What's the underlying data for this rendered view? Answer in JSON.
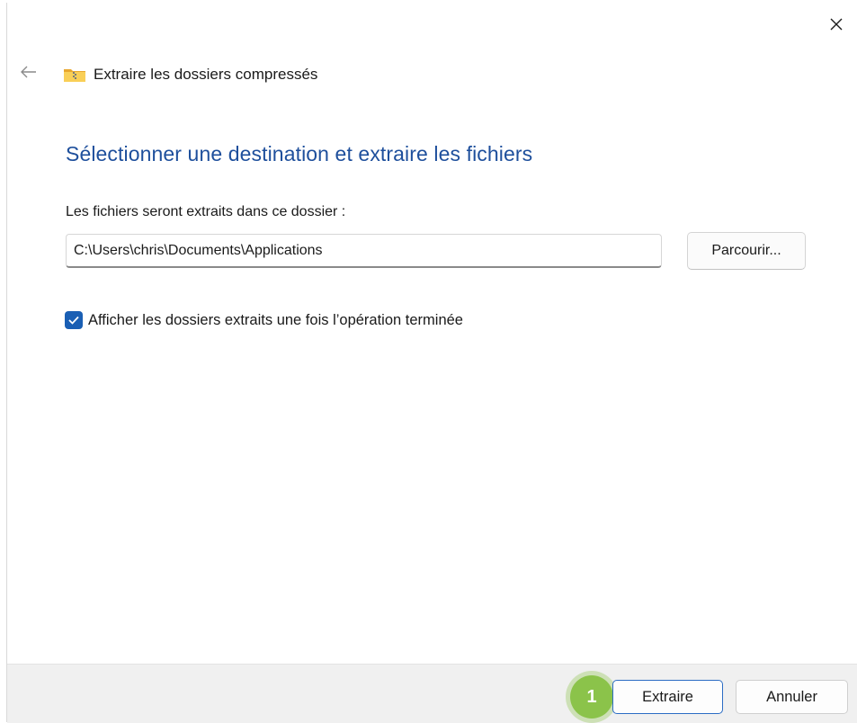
{
  "window": {
    "title": "Extraire les dossiers compressés"
  },
  "main": {
    "heading": "Sélectionner une destination et extraire les fichiers",
    "destination_label": "Les fichiers seront extraits dans ce dossier :",
    "destination_path": "C:\\Users\\chris\\Documents\\Applications",
    "browse_label": "Parcourir...",
    "show_folders_label": "Afficher les dossiers extraits une fois l’opération terminée",
    "show_folders_checked": true
  },
  "footer": {
    "step_number": "1",
    "extract_label": "Extraire",
    "cancel_label": "Annuler"
  },
  "colors": {
    "heading": "#1e4f9c",
    "checkbox": "#1a5fb4",
    "primary_border": "#2b6cc4",
    "step_badge": "#8bc34a",
    "footer_bg": "#f0f0f0"
  },
  "icons": {
    "close": "close-icon",
    "back": "back-arrow-icon",
    "folder": "zip-folder-icon",
    "check": "checkmark-icon"
  }
}
